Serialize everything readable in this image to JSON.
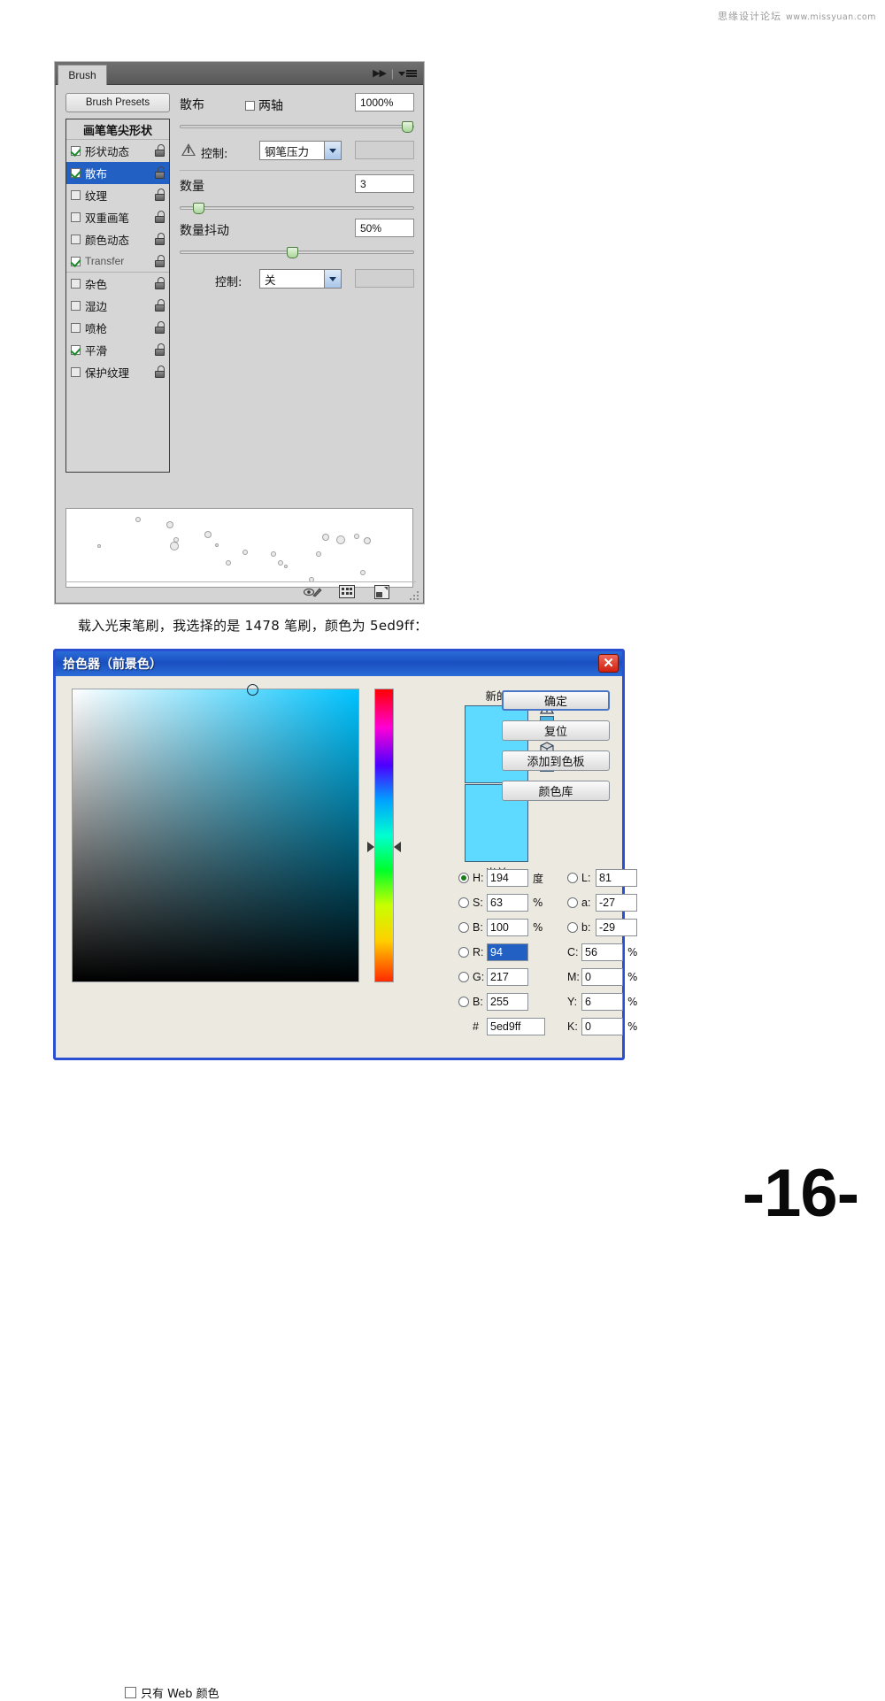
{
  "watermark": {
    "site": "思缘设计论坛",
    "url": "www.missyuan.com"
  },
  "page_number": "-16-",
  "caption": "载入光束笔刷，我选择的是 1478 笔刷，颜色为 5ed9ff：",
  "brush_panel": {
    "tab_label": "Brush",
    "presets_button": "Brush Presets",
    "list_header": "画笔笔尖形状",
    "options": [
      {
        "label": "形状动态",
        "checked": true,
        "latin": false,
        "selected": false,
        "group_end": false
      },
      {
        "label": "散布",
        "checked": true,
        "latin": false,
        "selected": true,
        "group_end": false
      },
      {
        "label": "纹理",
        "checked": false,
        "latin": false,
        "selected": false,
        "group_end": false
      },
      {
        "label": "双重画笔",
        "checked": false,
        "latin": false,
        "selected": false,
        "group_end": false
      },
      {
        "label": "颜色动态",
        "checked": false,
        "latin": false,
        "selected": false,
        "group_end": false
      },
      {
        "label": "Transfer",
        "checked": true,
        "latin": true,
        "selected": false,
        "group_end": true
      },
      {
        "label": "杂色",
        "checked": false,
        "latin": false,
        "selected": false,
        "group_end": false
      },
      {
        "label": "湿边",
        "checked": false,
        "latin": false,
        "selected": false,
        "group_end": false
      },
      {
        "label": "喷枪",
        "checked": false,
        "latin": false,
        "selected": false,
        "group_end": false
      },
      {
        "label": "平滑",
        "checked": true,
        "latin": false,
        "selected": false,
        "group_end": false
      },
      {
        "label": "保护纹理",
        "checked": false,
        "latin": false,
        "selected": false,
        "group_end": false
      }
    ],
    "scatter": {
      "label": "散布",
      "both_axes_label": "两轴",
      "both_axes_checked": false,
      "value": "1000%",
      "slider_percent": 97
    },
    "control1": {
      "label": "控制:",
      "value": "钢笔压力"
    },
    "count": {
      "label": "数量",
      "value": "3",
      "slider_percent": 8
    },
    "count_jitter": {
      "label": "数量抖动",
      "value": "50%",
      "slider_percent": 48
    },
    "control2": {
      "label": "控制:",
      "value": "关"
    },
    "footer_icons": [
      "toggle-brush-preview-icon",
      "brush-presets-grid-icon",
      "new-brush-icon"
    ]
  },
  "color_picker": {
    "title": "拾色器（前景色）",
    "close_label": "✕",
    "new_label": "新的",
    "current_label": "当前",
    "new_color": "#5ed9ff",
    "current_color": "#5ed9ff",
    "alert_chip_color": "#4ab4e0",
    "cube_chip_color": "#5ed9ff",
    "buttons": [
      {
        "label": "确定",
        "primary": true
      },
      {
        "label": "复位",
        "primary": false
      },
      {
        "label": "添加到色板",
        "primary": false
      },
      {
        "label": "颜色库",
        "primary": false
      }
    ],
    "hsb": [
      {
        "name": "H:",
        "value": "194",
        "unit": "度",
        "selected": true
      },
      {
        "name": "S:",
        "value": "63",
        "unit": "%",
        "selected": false
      },
      {
        "name": "B:",
        "value": "100",
        "unit": "%",
        "selected": false
      }
    ],
    "rgb": [
      {
        "name": "R:",
        "value": "94",
        "unit": "",
        "selected": false,
        "field_selected": true
      },
      {
        "name": "G:",
        "value": "217",
        "unit": "",
        "selected": false,
        "field_selected": false
      },
      {
        "name": "B:",
        "value": "255",
        "unit": "",
        "selected": false,
        "field_selected": false
      }
    ],
    "lab": [
      {
        "name": "L:",
        "value": "81",
        "unit": "",
        "selected": false
      },
      {
        "name": "a:",
        "value": "-27",
        "unit": "",
        "selected": false
      },
      {
        "name": "b:",
        "value": "-29",
        "unit": "",
        "selected": false
      }
    ],
    "cmyk": [
      {
        "name": "C:",
        "value": "56",
        "unit": "%"
      },
      {
        "name": "M:",
        "value": "0",
        "unit": "%"
      },
      {
        "name": "Y:",
        "value": "6",
        "unit": "%"
      },
      {
        "name": "K:",
        "value": "0",
        "unit": "%"
      }
    ],
    "hex": {
      "name": "#",
      "value": "5ed9ff"
    },
    "web_only": {
      "label": "只有 Web 颜色",
      "checked": false
    },
    "hue_degrees": 194,
    "marker_x_percent": 63,
    "marker_y_percent": 0
  }
}
